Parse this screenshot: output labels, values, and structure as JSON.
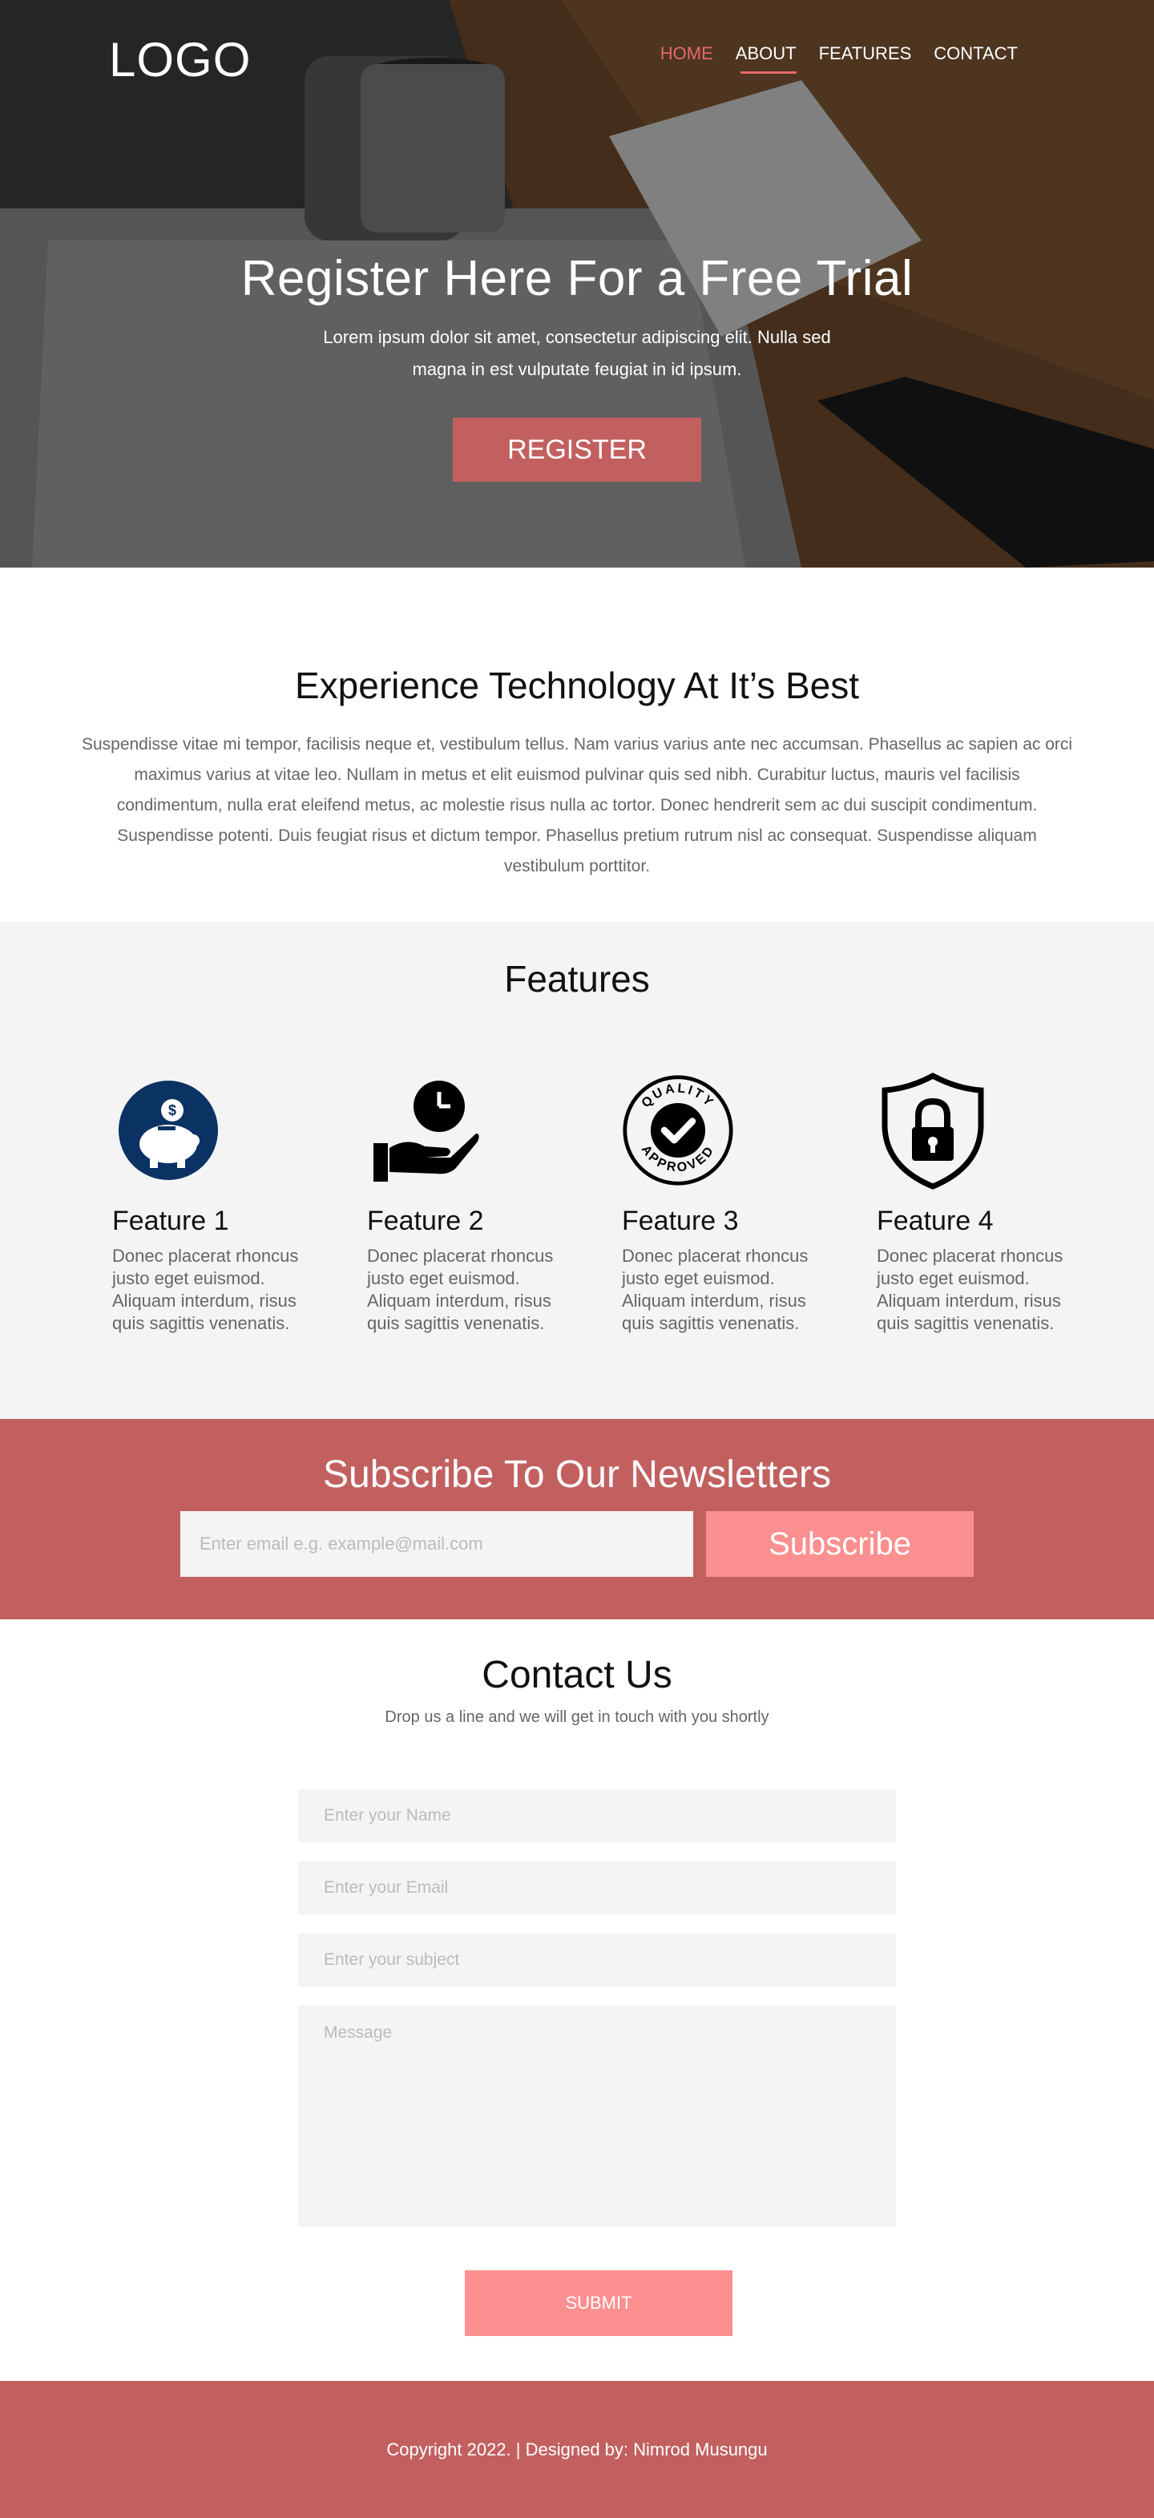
{
  "nav": {
    "logo": "LOGO",
    "items": [
      {
        "label": "HOME"
      },
      {
        "label": "ABOUT"
      },
      {
        "label": "FEATURES"
      },
      {
        "label": "CONTACT"
      }
    ]
  },
  "hero": {
    "title": "Register Here For a Free Trial",
    "subtitle": "Lorem ipsum dolor sit amet, consectetur adipiscing elit. Nulla sed magna in est vulputate feugiat in id ipsum.",
    "button": "REGISTER"
  },
  "about": {
    "title": "Experience Technology At It’s Best",
    "text": "Suspendisse vitae mi tempor, facilisis neque et, vestibulum tellus. Nam varius varius ante nec accumsan. Phasellus ac sapien ac orci maximus varius at vitae leo. Nullam in metus et elit euismod pulvinar quis sed nibh. Curabitur luctus, mauris vel facilisis condimentum, nulla erat eleifend metus, ac molestie risus nulla ac tortor. Donec hendrerit sem ac dui suscipit condimentum. Suspendisse potenti. Duis feugiat risus et dictum tempor. Phasellus pretium rutrum nisl ac consequat. Suspendisse aliquam vestibulum porttitor."
  },
  "features": {
    "title": "Features",
    "items": [
      {
        "name": "Feature 1",
        "desc": "Donec placerat rhoncus justo eget euismod. Aliquam interdum, risus quis sagittis venenatis.",
        "icon": "piggy-bank-icon"
      },
      {
        "name": "Feature 2",
        "desc": "Donec placerat rhoncus justo eget euismod. Aliquam interdum, risus quis sagittis venenatis.",
        "icon": "hand-clock-icon"
      },
      {
        "name": "Feature 3",
        "desc": "Donec placerat rhoncus justo eget euismod. Aliquam interdum, risus quis sagittis venenatis.",
        "icon": "quality-approved-icon",
        "badge_top": "QUALITY",
        "badge_bottom": "APPROVED"
      },
      {
        "name": "Feature 4",
        "desc": "Donec placerat rhoncus justo eget euismod. Aliquam interdum, risus quis sagittis venenatis.",
        "icon": "shield-lock-icon"
      }
    ]
  },
  "newsletter": {
    "title": "Subscribe To Our Newsletters",
    "placeholder": "Enter email e.g. example@mail.com",
    "button": "Subscribe"
  },
  "contact": {
    "title": "Contact Us",
    "subtitle": "Drop us a line and we will get in touch with you shortly",
    "name_placeholder": "Enter your Name",
    "email_placeholder": "Enter your Email",
    "subject_placeholder": "Enter your subject",
    "message_placeholder": "Message",
    "submit": "SUBMIT"
  },
  "footer": {
    "text": "Copyright 2022. | Designed by: Nimrod Musungu"
  },
  "colors": {
    "accent": "#c26060",
    "button_light": "#fc8f8f",
    "nav_active": "#e46a6a",
    "icon_navy": "#0a3263"
  }
}
